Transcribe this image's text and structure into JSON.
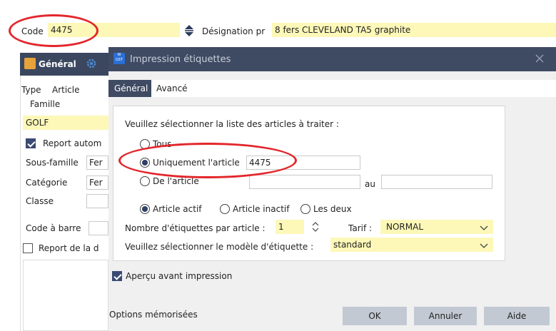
{
  "header": {
    "code_label": "Code",
    "code_value": "4475",
    "designation_label": "Désignation pr",
    "designation_value": "8 fers CLEVELAND TA5 graphite"
  },
  "bg": {
    "tab_general": "Général",
    "type_label": "Type",
    "type_value": "Article",
    "famille_label": "Famille",
    "famille_value": "GOLF",
    "report_auto": "Report autom",
    "sous_famille_label": "Sous-famille",
    "sous_famille_value": "Fer",
    "categorie_label": "Catégorie",
    "categorie_value": "Fer",
    "classe_label": "Classe",
    "code_barre_label": "Code à barre",
    "report_de_la": "Report de la d"
  },
  "dialog": {
    "title": "Impression étiquettes",
    "logo_text": "W GST",
    "tabs": [
      {
        "label": "Général",
        "active": true
      },
      {
        "label": "Avancé",
        "active": false
      }
    ],
    "select_list_label": "Veuillez sélectionner la liste des articles à traiter :",
    "opt_tous": "Tous",
    "opt_uniquement": "Uniquement l'article",
    "uniquement_value": "4475",
    "opt_de_article": "De l'article",
    "au_label": "au",
    "opt_actif": "Article actif",
    "opt_inactif": "Article inactif",
    "opt_les_deux": "Les deux",
    "nb_label": "Nombre d'étiquettes par article :",
    "nb_value": "1",
    "tarif_label": "Tarif :",
    "tarif_value": "NORMAL",
    "modele_label": "Veuillez sélectionner le modèle d'étiquette :",
    "modele_value": "standard",
    "apercu_label": "Aperçu avant impression",
    "options_label": "Options mémorisées",
    "ok_label": "OK",
    "annuler_label": "Annuler",
    "aide_label": "Aide"
  },
  "colors": {
    "dialog_header": "#3f4a63",
    "field_yellow": "#fdf8b8",
    "annotation_red": "#e3262b",
    "button_grey": "#c3c9d3"
  }
}
